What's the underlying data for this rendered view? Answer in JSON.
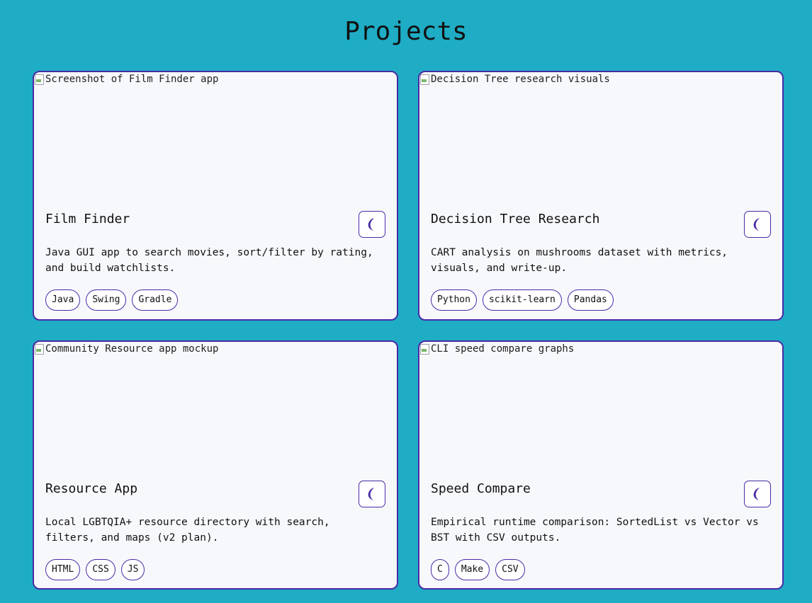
{
  "page": {
    "title": "Projects"
  },
  "colors": {
    "background": "#1facc5",
    "card_background": "#f7f8fc",
    "accent": "#4a2aa5"
  },
  "projects": [
    {
      "image_alt": "Screenshot of Film Finder app",
      "title": "Film Finder",
      "toggle_icon": "moon-icon",
      "description": "Java GUI app to search movies, sort/filter by rating, and build watchlists.",
      "tags": [
        "Java",
        "Swing",
        "Gradle"
      ]
    },
    {
      "image_alt": "Decision Tree research visuals",
      "title": "Decision Tree Research",
      "toggle_icon": "moon-icon",
      "description": "CART analysis on mushrooms dataset with metrics, visuals, and write-up.",
      "tags": [
        "Python",
        "scikit-learn",
        "Pandas"
      ]
    },
    {
      "image_alt": "Community Resource app mockup",
      "title": "Resource App",
      "toggle_icon": "moon-icon",
      "description": "Local LGBTQIA+ resource directory with search, filters, and maps (v2 plan).",
      "tags": [
        "HTML",
        "CSS",
        "JS"
      ]
    },
    {
      "image_alt": "CLI speed compare graphs",
      "title": "Speed Compare",
      "toggle_icon": "moon-icon",
      "description": "Empirical runtime comparison: SortedList vs Vector vs BST with CSV outputs.",
      "tags": [
        "C",
        "Make",
        "CSV"
      ]
    }
  ]
}
